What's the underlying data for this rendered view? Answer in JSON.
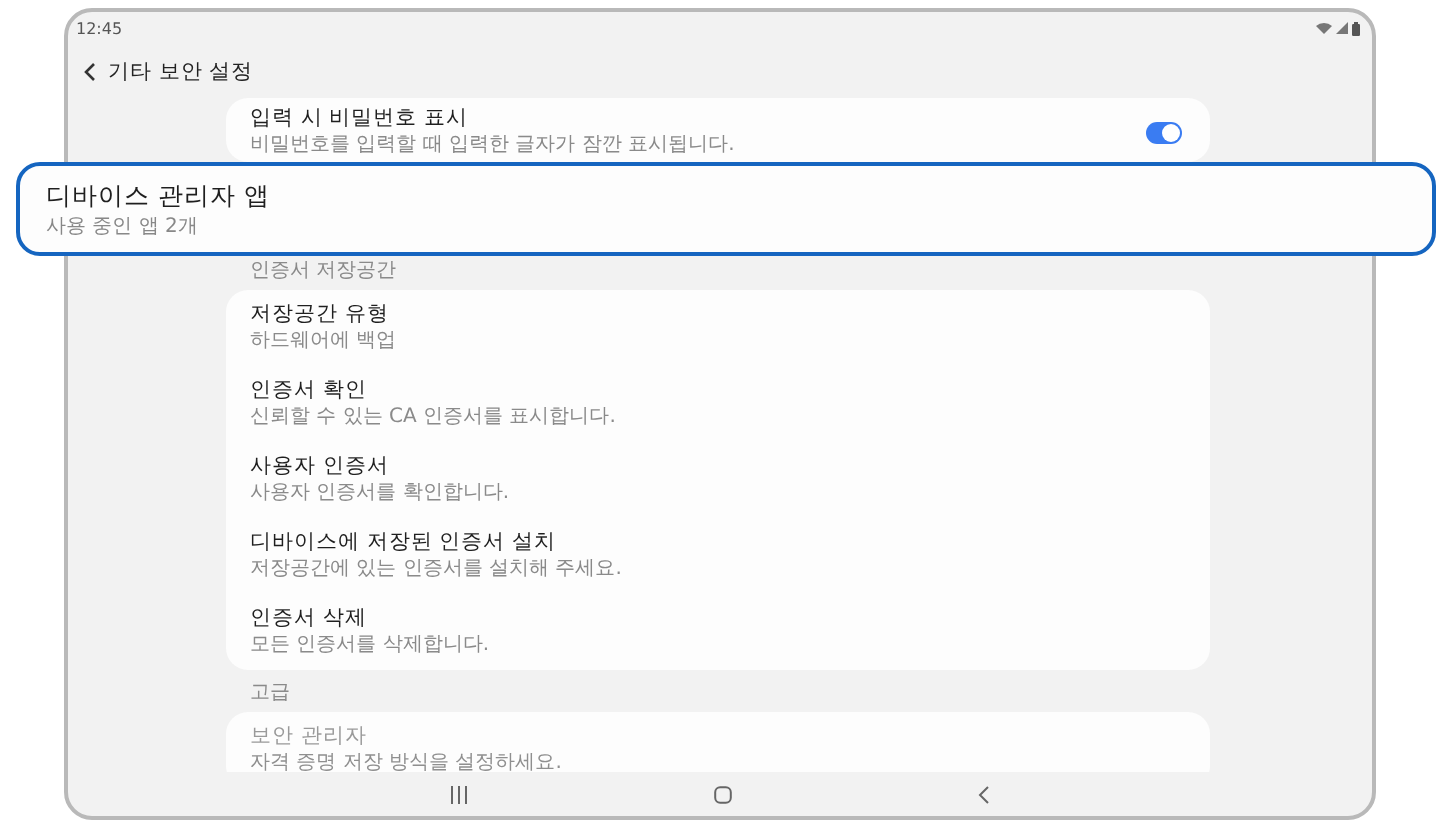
{
  "status_bar": {
    "time": "12:45"
  },
  "header": {
    "title": "기타 보안 설정"
  },
  "sections": [
    {
      "items": [
        {
          "kind": "toggle",
          "title": "입력 시 비밀번호 표시",
          "subtitle": "비밀번호를 입력할 때 입력한 글자가 잠깐 표시됩니다.",
          "on": true,
          "disabled": false
        }
      ]
    },
    {
      "label": "인증서 저장공간",
      "items": [
        {
          "kind": "link",
          "title": "저장공간 유형",
          "subtitle": "하드웨어에 백업",
          "disabled": false
        },
        {
          "kind": "link",
          "title": "인증서 확인",
          "subtitle": "신뢰할 수 있는 CA 인증서를 표시합니다.",
          "disabled": false
        },
        {
          "kind": "link",
          "title": "사용자 인증서",
          "subtitle": "사용자 인증서를 확인합니다.",
          "disabled": false
        },
        {
          "kind": "link",
          "title": "디바이스에 저장된 인증서 설치",
          "subtitle": "저장공간에 있는 인증서를 설치해 주세요.",
          "disabled": false
        },
        {
          "kind": "link",
          "title": "인증서 삭제",
          "subtitle": "모든 인증서를 삭제합니다.",
          "disabled": false
        }
      ]
    },
    {
      "label": "고급",
      "items": [
        {
          "kind": "link",
          "title": "보안 관리자",
          "subtitle": "자격 증명 저장 방식을 설정하세요.",
          "disabled": true
        }
      ]
    }
  ],
  "callout": {
    "title": "디바이스 관리자 앱",
    "subtitle": "사용 중인 앱 2개"
  }
}
